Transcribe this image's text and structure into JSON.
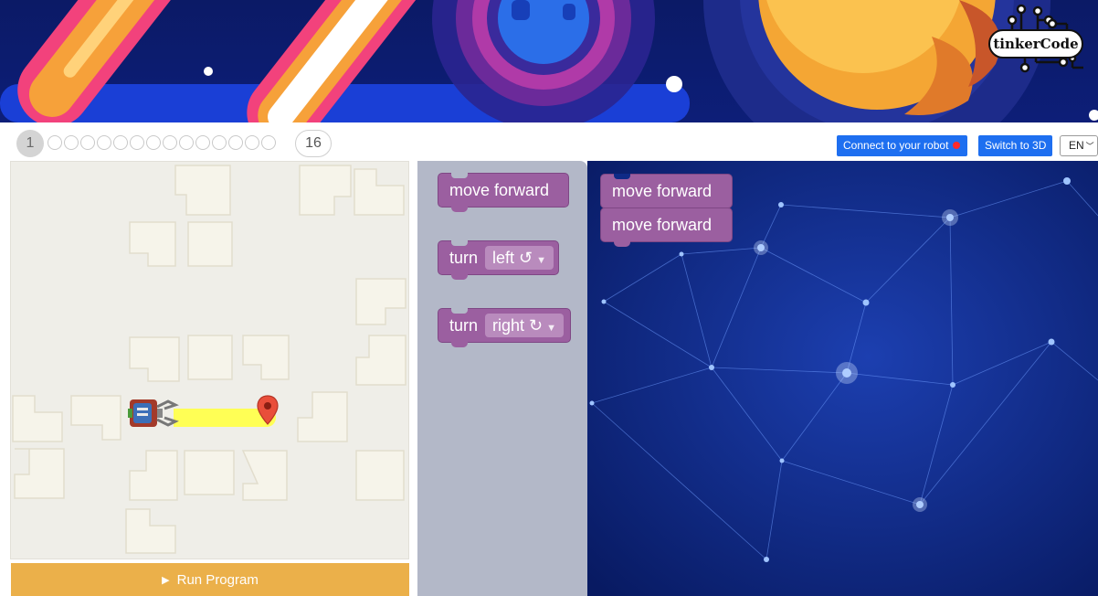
{
  "app": {
    "logo_text": "tinkerCode"
  },
  "levels": {
    "first": "1",
    "last": "16",
    "dot_count": 14
  },
  "header_buttons": {
    "connect_label": "Connect to your robot",
    "switch_label": "Switch to 3D",
    "language": "EN"
  },
  "game": {
    "run_label": "Run Program"
  },
  "toolbox": {
    "move_forward": "move forward",
    "turn_label": "turn",
    "turn_left_option": "left ↺",
    "turn_right_option": "right ↻"
  },
  "workspace": {
    "blocks": [
      "move forward",
      "move forward"
    ]
  },
  "colors": {
    "block_purple": "#9b5fa0",
    "button_blue": "#1e6ff0",
    "run_orange": "#ebb04a",
    "workspace_bg": "#0a1f6e",
    "toolbox_bg": "#b3b8c8"
  }
}
